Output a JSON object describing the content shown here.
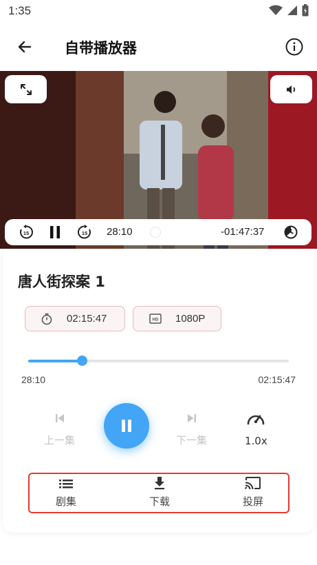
{
  "status_bar": {
    "time": "1:35",
    "icons": [
      "wifi-icon",
      "signal-icon",
      "battery-icon"
    ]
  },
  "app_bar": {
    "title": "自带播放器",
    "back_icon": "arrow-left-icon",
    "info_icon": "info-circle-icon"
  },
  "player": {
    "fullscreen_icon": "expand-arrows-icon",
    "volume_icon": "volume-icon",
    "rewind_icon": "replay-15-icon",
    "pause_icon": "pause-icon",
    "forward_icon": "forward-15-icon",
    "current_time": "28:10",
    "remaining_time": "-01:47:37",
    "timer_icon": "sleep-timer-icon"
  },
  "episode": {
    "title": "唐人街探案 1",
    "duration": "02:15:47",
    "resolution": "1080P",
    "duration_icon": "stopwatch-icon",
    "resolution_icon": "hd-icon"
  },
  "progress": {
    "current": "28:10",
    "total": "02:15:47",
    "fraction": 0.207
  },
  "controls": {
    "prev_label": "上一集",
    "next_label": "下一集",
    "speed_label": "1.0x",
    "accent_color": "#42a5f5"
  },
  "bottom_actions": [
    {
      "label": "剧集",
      "icon": "list-icon"
    },
    {
      "label": "下载",
      "icon": "download-icon"
    },
    {
      "label": "投屏",
      "icon": "cast-icon"
    }
  ],
  "highlight_color": "#e53935"
}
